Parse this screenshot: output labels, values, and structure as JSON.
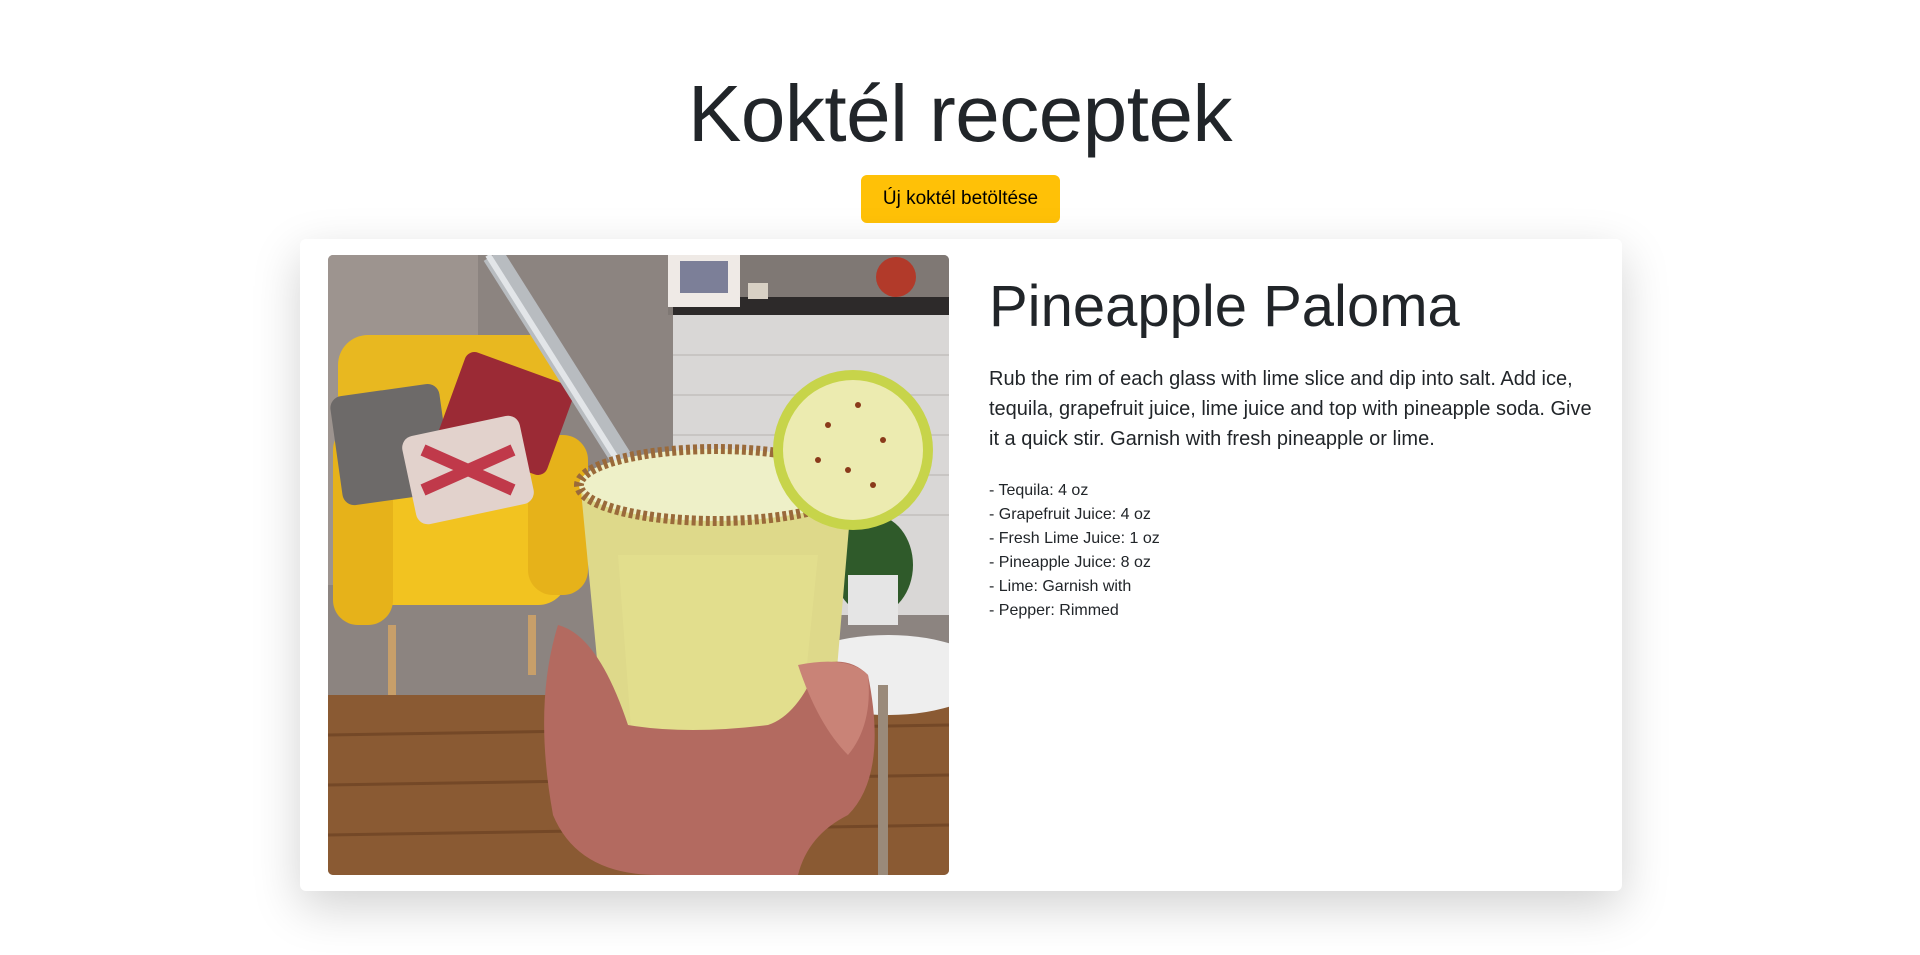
{
  "header": {
    "title": "Koktél receptek",
    "load_button_label": "Új koktél betöltése"
  },
  "cocktail": {
    "name": "Pineapple Paloma",
    "instructions": "Rub the rim of each glass with lime slice and dip into salt. Add ice, tequila, grapefruit juice, lime juice and top with pineapple soda. Give it a quick stir. Garnish with fresh pineapple or lime.",
    "ingredients": [
      "- Tequila: 4 oz",
      "- Grapefruit Juice: 4 oz",
      "- Fresh Lime Juice: 1 oz",
      "- Pineapple Juice: 8 oz",
      "- Lime: Garnish with",
      "- Pepper: Rimmed"
    ]
  },
  "colors": {
    "button": "#ffc107",
    "text": "#212529"
  }
}
